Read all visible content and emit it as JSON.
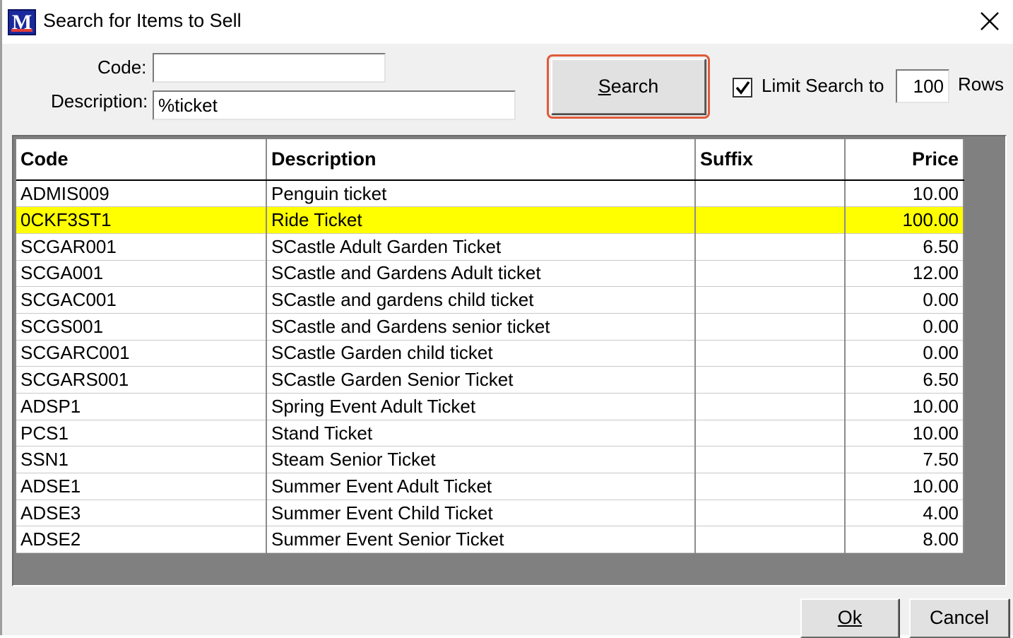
{
  "window": {
    "title": "Search for Items to Sell",
    "app_icon": "im-logo-icon"
  },
  "form": {
    "code_label": "Code:",
    "code_value": "",
    "description_label": "Description:",
    "description_value": "%ticket",
    "search_button_label": "Search",
    "search_button_mnemonic": "S",
    "limit_checked": true,
    "limit_label": "Limit Search to",
    "limit_rows_value": "100",
    "rows_label": "Rows"
  },
  "table": {
    "columns": [
      "Code",
      "Description",
      "Suffix",
      "Price"
    ],
    "selected_row_index": 1,
    "selected_row_color": "#ffff00",
    "rows": [
      {
        "code": "ADMIS009",
        "description": "Penguin ticket",
        "suffix": "",
        "price": "10.00"
      },
      {
        "code": "0CKF3ST1",
        "description": "Ride Ticket",
        "suffix": "",
        "price": "100.00"
      },
      {
        "code": "SCGAR001",
        "description": "SCastle Adult Garden Ticket",
        "suffix": "",
        "price": "6.50"
      },
      {
        "code": "SCGA001",
        "description": "SCastle and Gardens Adult ticket",
        "suffix": "",
        "price": "12.00"
      },
      {
        "code": "SCGAC001",
        "description": "SCastle and gardens child ticket",
        "suffix": "",
        "price": "0.00"
      },
      {
        "code": "SCGS001",
        "description": "SCastle and Gardens senior ticket",
        "suffix": "",
        "price": "0.00"
      },
      {
        "code": "SCGARC001",
        "description": "SCastle Garden child ticket",
        "suffix": "",
        "price": "0.00"
      },
      {
        "code": "SCGARS001",
        "description": "SCastle Garden Senior Ticket",
        "suffix": "",
        "price": "6.50"
      },
      {
        "code": "ADSP1",
        "description": "Spring Event Adult Ticket",
        "suffix": "",
        "price": "10.00"
      },
      {
        "code": "PCS1",
        "description": "Stand Ticket",
        "suffix": "",
        "price": "10.00"
      },
      {
        "code": "SSN1",
        "description": "Steam Senior Ticket",
        "suffix": "",
        "price": "7.50"
      },
      {
        "code": "ADSE1",
        "description": "Summer Event Adult Ticket",
        "suffix": "",
        "price": "10.00"
      },
      {
        "code": "ADSE3",
        "description": "Summer Event Child Ticket",
        "suffix": "",
        "price": "4.00"
      },
      {
        "code": "ADSE2",
        "description": "Summer Event Senior Ticket",
        "suffix": "",
        "price": "8.00"
      }
    ]
  },
  "footer": {
    "ok_label": "Ok",
    "cancel_label": "Cancel"
  }
}
